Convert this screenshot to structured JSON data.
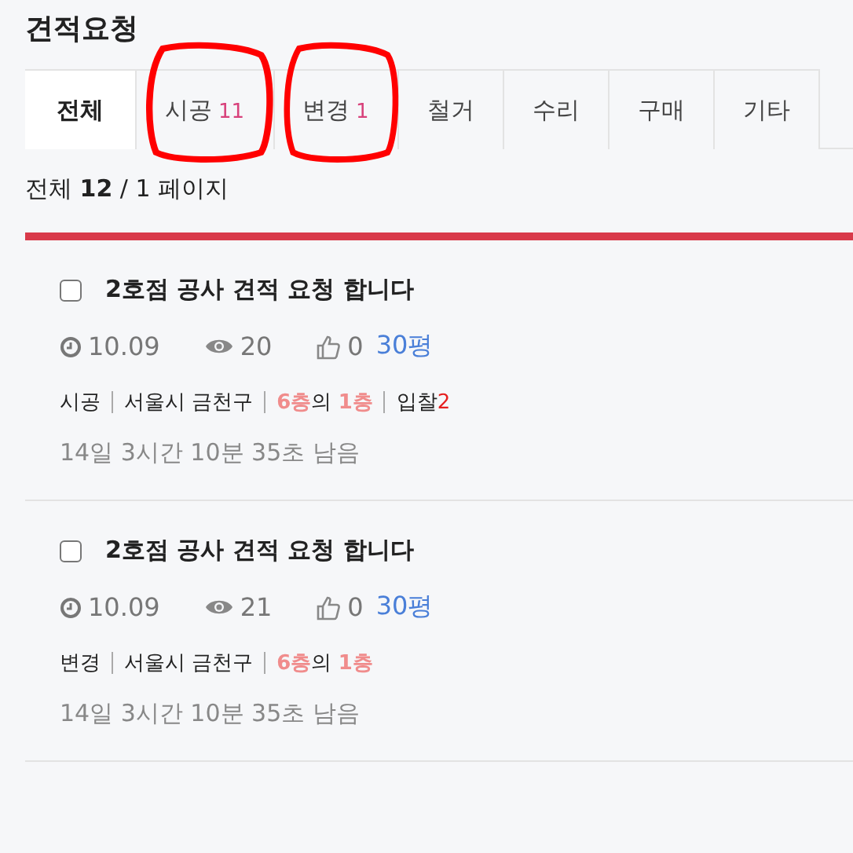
{
  "title": "견적요청",
  "tabs": [
    {
      "label": "전체",
      "selected": true,
      "circled": false
    },
    {
      "label": "시공",
      "count": "11",
      "selected": false,
      "circled": true
    },
    {
      "label": "변경",
      "count": "1",
      "selected": false,
      "circled": true
    },
    {
      "label": "철거",
      "selected": false,
      "circled": false
    },
    {
      "label": "수리",
      "selected": false,
      "circled": false
    },
    {
      "label": "구매",
      "selected": false,
      "circled": false
    },
    {
      "label": "기타",
      "selected": false,
      "circled": false
    }
  ],
  "summary": "전체 **12** / 1 페이지",
  "posts": [
    {
      "checked": false,
      "title": "2호점 공사 견적 요청 합니다",
      "date": "10.09",
      "views": "20",
      "likes": "0",
      "size": "30평",
      "category": "시공",
      "location": "서울시 금천구",
      "floors": "**6층**의 **1층**",
      "bid": {
        "label": "입찰",
        "count": "2"
      },
      "remaining": "14일 3시간 10분 35초 남음"
    },
    {
      "checked": false,
      "title": "2호점 공사 견적 요청 합니다",
      "date": "10.09",
      "views": "21",
      "likes": "0",
      "size": "30평",
      "category": "변경",
      "location": "서울시 금천구",
      "floors": "**6층**의 **1층**",
      "remaining": "14일 3시간 10분 35초 남음"
    }
  ]
}
